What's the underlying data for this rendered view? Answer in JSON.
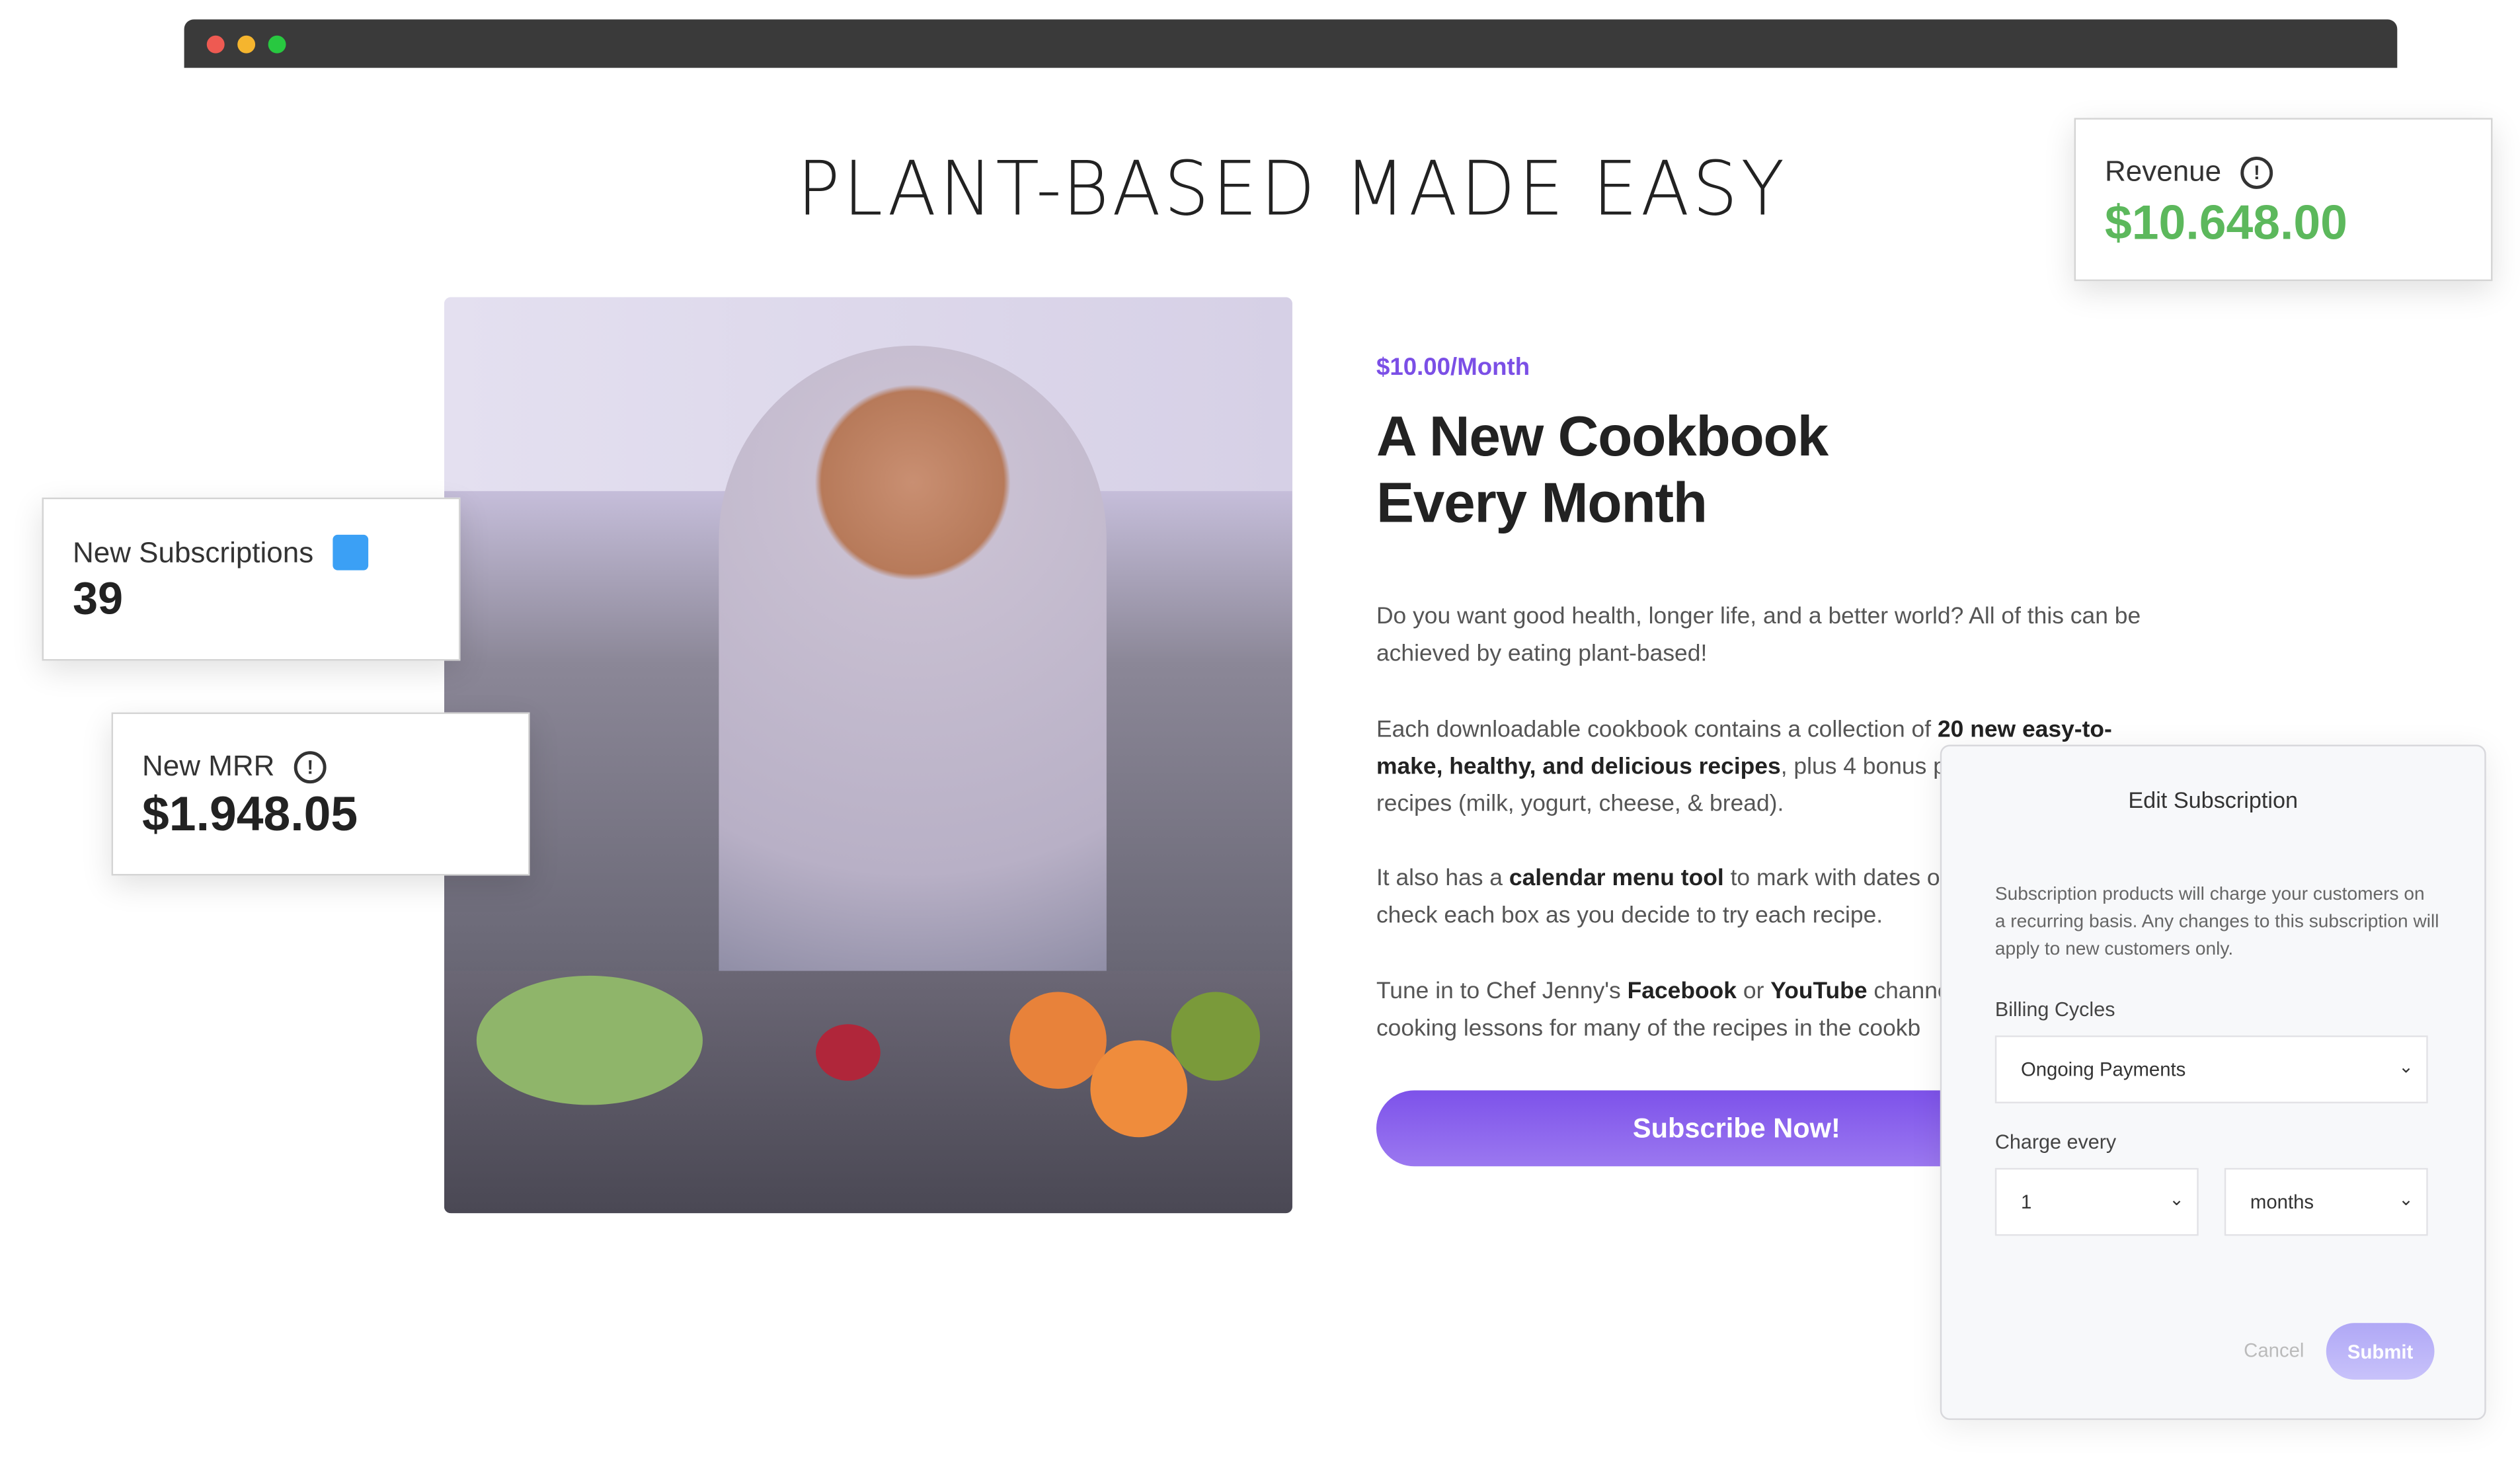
{
  "browser": {
    "dots": [
      "#ee5a52",
      "#f5b52e",
      "#28c840"
    ]
  },
  "page": {
    "title": "PLANT-BASED MADE EASY",
    "price": "$10.00/Month",
    "headline_line1": "A New Cookbook",
    "headline_line2": "Every Month",
    "para1": "Do you want good health, longer life, and a better world? All of this can be achieved by eating plant-based!",
    "para2_a": "Each downloadable cookbook contains a collection of ",
    "para2_b": "20 new easy-to-make, healthy, and delicious recipes",
    "para2_c": ", plus 4 bonus pl",
    "para2_d": "recipes (milk, yogurt, cheese, & bread).",
    "para3_a": "It also has a ",
    "para3_b": "calendar menu tool",
    "para3_c": " to mark with dates o",
    "para3_d": "check each box as you decide to try each recipe.",
    "para4_a": "Tune in to Chef Jenny's ",
    "para4_b": "Facebook",
    "para4_c": " or ",
    "para4_d": "YouTube",
    "para4_e": " channe",
    "para4_f": "cooking lessons for many of the recipes in the cookb",
    "subscribe_label": "Subscribe Now!",
    "accent": "#7b4fe6"
  },
  "cards": {
    "revenue": {
      "label": "Revenue",
      "value": "$10.648.00",
      "color": "#5cb85c",
      "icon": "info-icon"
    },
    "new_subscriptions": {
      "label": "New Subscriptions",
      "value": "39",
      "color": "#3ba0f5",
      "icon": "blue-square-icon"
    },
    "new_mrr": {
      "label": "New MRR",
      "value": "$1.948.05",
      "icon": "info-icon"
    }
  },
  "modal": {
    "title": "Edit Subscription",
    "description": "Subscription products will charge your customers on a recurring basis. Any changes to this subscription will apply to new customers only.",
    "billing_label": "Billing Cycles",
    "billing_value": "Ongoing Payments",
    "charge_label": "Charge every",
    "charge_count": "1",
    "charge_unit": "months",
    "cancel_label": "Cancel",
    "submit_label": "Submit"
  }
}
